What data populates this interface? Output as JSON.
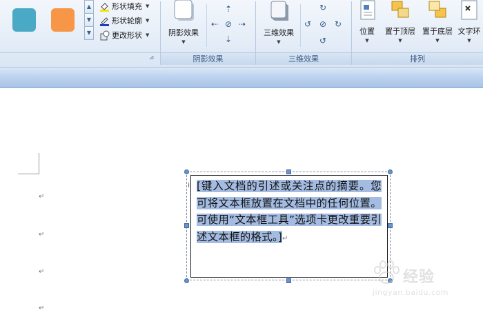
{
  "ribbon": {
    "shape_styles": {
      "swatches": [
        {
          "name": "teal-style",
          "color": "#4aa9c4"
        },
        {
          "name": "orange-style",
          "color": "#f79646"
        }
      ],
      "commands": {
        "fill": "形状填充",
        "outline": "形状轮廓",
        "change": "更改形状"
      }
    },
    "shadow_effects": {
      "button": "阴影效果",
      "group_label": "阴影效果"
    },
    "three_d_effects": {
      "button": "三维效果",
      "group_label": "三维效果"
    },
    "arrange": {
      "position": "位置",
      "bring_front": "置于顶层",
      "send_back": "置于底层",
      "text_wrap": "文字环",
      "group_label": "排列"
    }
  },
  "document": {
    "textbox_text": "[键入文档的引述或关注点的摘要。您可将文本框放置在文档中的任何位置。可使用“文本框工具”选项卡更改重要引述文本框的格式。]",
    "paragraph_mark": "↵"
  },
  "watermark": {
    "brand": "经验",
    "url": "jingyan.baidu.com"
  },
  "colors": {
    "selection": "#a4bce2",
    "ribbon_label": "#3b5a82"
  }
}
